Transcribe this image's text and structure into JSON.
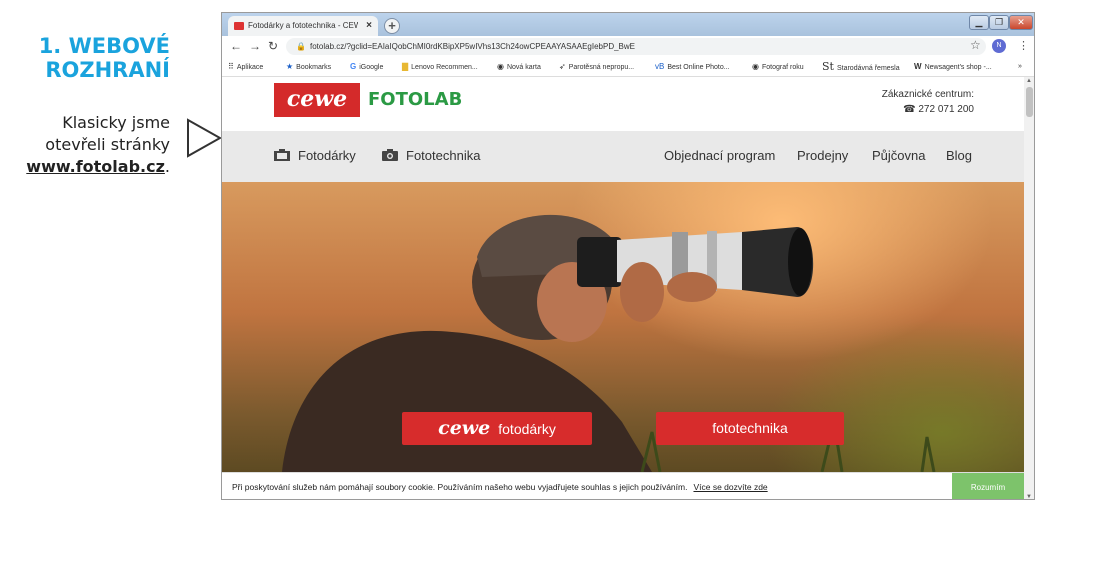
{
  "annotation": {
    "title_line1": "1. WEBOVÉ",
    "title_line2": "ROZHRANÍ",
    "text_line1": "Klasicky jsme",
    "text_line2": "otevřeli stránky",
    "link": "www.fotolab.cz",
    "link_suffix": "."
  },
  "browser": {
    "tab_title": "Fotodárky a fototechnika - CEWE",
    "tab_close": "×",
    "new_tab": "+",
    "url": "fotolab.cz/?gclid=EAIaIQobChMI0rdKBipXP5wIVhs13Ch24owCPEAAYASAAEgIebPD_BwE",
    "profile_initial": "N",
    "bookmarks": [
      {
        "icon": "apps-icon",
        "label": "Aplikace"
      },
      {
        "icon": "star-icon",
        "label": "Bookmarks"
      },
      {
        "icon": "google-icon",
        "label": "iGoogle"
      },
      {
        "icon": "folder-icon",
        "label": "Lenovo Recommen..."
      },
      {
        "icon": "globe-icon",
        "label": "Nová karta"
      },
      {
        "icon": "bird-icon",
        "label": "Parotěsná nepropu..."
      },
      {
        "icon": "vb-icon",
        "label": "Best Online Photo..."
      },
      {
        "icon": "camera-icon",
        "label": "Fotograf roku"
      },
      {
        "icon": "st-icon",
        "label": "Starodávná řemesla"
      },
      {
        "icon": "w-icon",
        "label": "Newsagent's shop -..."
      }
    ],
    "bookmarks_more": "»"
  },
  "site": {
    "logo_cewe": "cewe",
    "logo_fotolab": "FOTOLAB",
    "contact_label": "Zákaznické centrum:",
    "contact_phone": "272 071 200",
    "nav_left": [
      {
        "label": "Fotodárky",
        "icon": "gift-photo-icon"
      },
      {
        "label": "Fototechnika",
        "icon": "camera-icon"
      }
    ],
    "nav_right": [
      "Objednací program",
      "Prodejny",
      "Půjčovna",
      "Blog"
    ],
    "hero_btn_left_brand": "cewe",
    "hero_btn_left_label": "fotodárky",
    "hero_btn_right_label": "fototechnika",
    "cookie_text": "Při poskytování služeb nám pomáhají soubory cookie. Používáním našeho webu vyjadřujete souhlas s jejich používáním.",
    "cookie_link": "Více se dozvíte zde",
    "cookie_button": "Rozumím"
  },
  "colors": {
    "annotation_title": "#1aa3dd",
    "cewe_red": "#d42a2a",
    "fotolab_green": "#2b9a44",
    "cookie_button": "#7dc36b"
  }
}
